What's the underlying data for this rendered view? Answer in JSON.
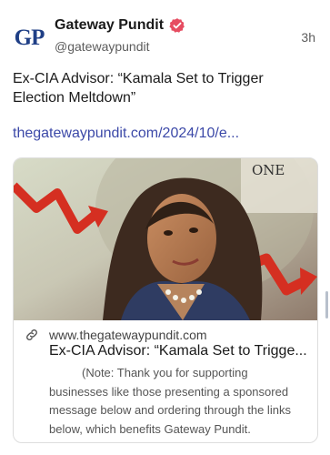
{
  "author": {
    "avatar_text": "GP",
    "name": "Gateway Pundit",
    "handle": "@gatewaypundit",
    "verified_icon": "verified-badge-icon"
  },
  "post": {
    "time": "3h",
    "text": "Ex-CIA Advisor: “Kamala Set to Trigger Election Meltdown”",
    "link": "thegatewaypundit.com/2024/10/e..."
  },
  "card": {
    "domain": "www.thegatewaypundit.com",
    "title": "Ex-CIA Advisor: “Kamala Set to Trigge...",
    "description": "(Note: Thank you for supporting businesses like those presenting a sponsored message below and ordering through the links below, which benefits Gateway Pundit."
  },
  "colors": {
    "verified": "#e64c61",
    "link": "#3c49a8",
    "avatar": "#1f3f86"
  }
}
